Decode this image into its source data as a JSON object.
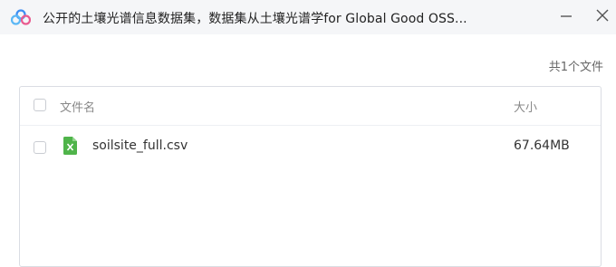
{
  "window": {
    "title": "公开的土壤光谱信息数据集，数据集从土壤光谱学for Global Good OSS..."
  },
  "summary": {
    "file_count": "共1个文件"
  },
  "table": {
    "columns": {
      "name": "文件名",
      "size": "大小"
    },
    "rows": [
      {
        "name": "soilsite_full.csv",
        "size": "67.64MB",
        "icon": "excel-file-icon"
      }
    ]
  },
  "colors": {
    "excel_green": "#4fb44a",
    "app_icon_blue": "#3d8ef3",
    "app_icon_pink": "#e95b8f"
  }
}
